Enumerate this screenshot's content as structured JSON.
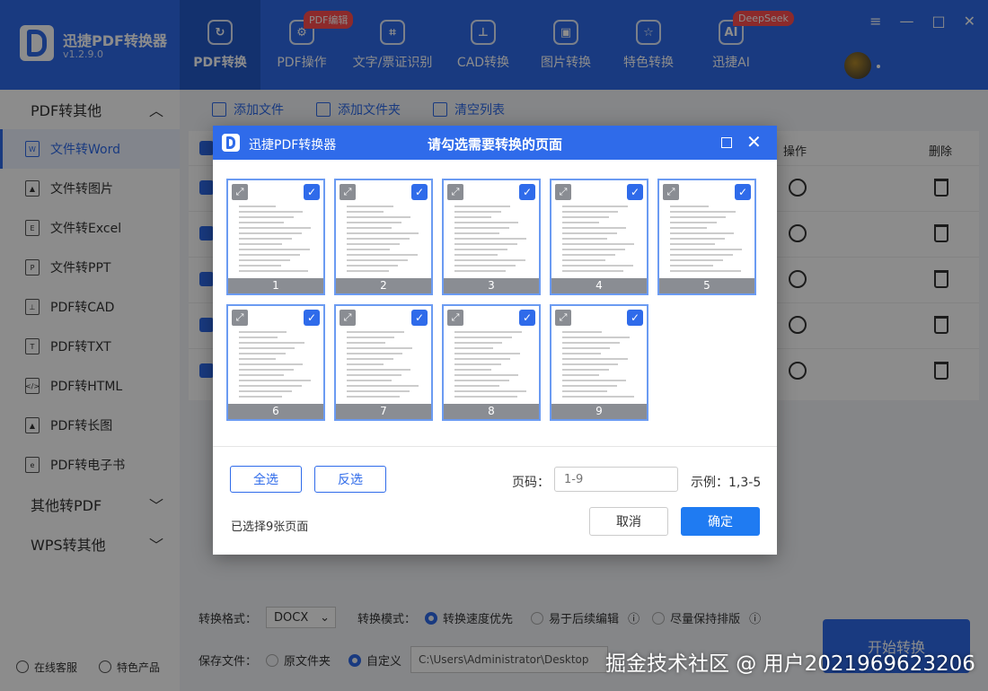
{
  "header": {
    "app_name": "迅捷PDF转换器",
    "version": "v1.2.9.0",
    "nav": [
      {
        "label": "PDF转换",
        "icon": "↻",
        "active": true
      },
      {
        "label": "PDF操作",
        "icon": "⚙",
        "badge": "PDF编辑"
      },
      {
        "label": "文字/票证识别",
        "icon": "⌗"
      },
      {
        "label": "CAD转换",
        "icon": "⊥"
      },
      {
        "label": "图片转换",
        "icon": "▣"
      },
      {
        "label": "特色转换",
        "icon": "☆"
      },
      {
        "label": "迅捷AI",
        "icon": "AI",
        "badge": "DeepSeek"
      }
    ],
    "window_controls": [
      "≡",
      "—",
      "□",
      "✕"
    ]
  },
  "sidebar": {
    "group1": "PDF转其他",
    "items": [
      {
        "label": "文件转Word",
        "icon": "W"
      },
      {
        "label": "文件转图片",
        "icon": "▲"
      },
      {
        "label": "文件转Excel",
        "icon": "E"
      },
      {
        "label": "文件转PPT",
        "icon": "P"
      },
      {
        "label": "PDF转CAD",
        "icon": "⊥"
      },
      {
        "label": "PDF转TXT",
        "icon": "T"
      },
      {
        "label": "PDF转HTML",
        "icon": "</>"
      },
      {
        "label": "PDF转长图",
        "icon": "▲"
      },
      {
        "label": "PDF转电子书",
        "icon": "e"
      }
    ],
    "group2": "其他转PDF",
    "group3": "WPS转其他",
    "bottom": {
      "service": "在线客服",
      "products": "特色产品"
    }
  },
  "toolbar": {
    "add_file": "添加文件",
    "add_folder": "添加文件夹",
    "clear_list": "清空列表"
  },
  "table": {
    "col_op": "操作",
    "col_delete": "删除",
    "rows": 5
  },
  "bottom_bar": {
    "format_label": "转换格式：",
    "format_value": "DOCX",
    "mode_label": "转换模式：",
    "mode_options": [
      "转换速度优先",
      "易于后续编辑",
      "尽量保持排版"
    ],
    "save_label": "保存文件：",
    "save_original": "原文件夹",
    "save_custom": "自定义",
    "save_path": "C:\\Users\\Administrator\\Desktop",
    "start_button": "开始转换"
  },
  "modal": {
    "app_name": "迅捷PDF转换器",
    "title": "请勾选需要转换的页面",
    "pages": [
      "1",
      "2",
      "3",
      "4",
      "5",
      "6",
      "7",
      "8",
      "9"
    ],
    "select_all": "全选",
    "invert": "反选",
    "page_label": "页码：",
    "page_input_placeholder": "1-9",
    "example": "示例：1,3-5",
    "selected_info": "已选择9张页面",
    "cancel": "取消",
    "confirm": "确定"
  },
  "watermark": "掘金技术社区 @ 用户2021969623206"
}
